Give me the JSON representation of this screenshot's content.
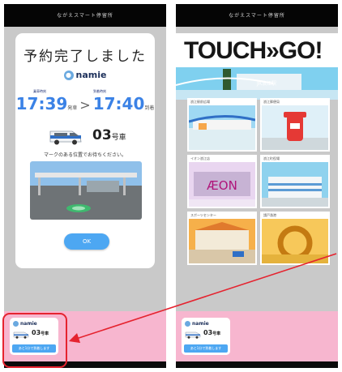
{
  "left_screen": {
    "status_title": "ながえスマート停留所",
    "heading": "予約完了しました",
    "brand": "namie",
    "departure": {
      "label": "乗車時刻",
      "time": "17:39",
      "suffix": "発車"
    },
    "arrival": {
      "label": "到着時刻",
      "time": "17:40",
      "suffix": "到着"
    },
    "arrow": ">",
    "vehicle": {
      "number": "03",
      "suffix": "号車"
    },
    "notice": "マークのある位置でお待ちください。",
    "ok_label": "OK",
    "mini_card": {
      "brand": "namie",
      "number": "03",
      "suffix": "号車",
      "bar_text": "あと1分で到着します"
    }
  },
  "right_screen": {
    "status_title": "ながえスマート停留所",
    "header": "TOUCH»GO!",
    "station_label": "JR浪江駅",
    "tiles": [
      {
        "caption": "浪江駅前広場"
      },
      {
        "caption": "浪江郵便局"
      },
      {
        "caption": "イオン浪江店"
      },
      {
        "caption": "浪江町役場"
      },
      {
        "caption": "スポーツセンター"
      },
      {
        "caption": "請戸漁港"
      }
    ],
    "tile_logo": "ÆON",
    "mini_card": {
      "brand": "namie",
      "number": "03",
      "suffix": "号車",
      "bar_text": "あと1分で到着します"
    }
  },
  "colors": {
    "accent": "#4da7f2",
    "pink": "#f7b6cf",
    "highlight": "#e5232f"
  }
}
